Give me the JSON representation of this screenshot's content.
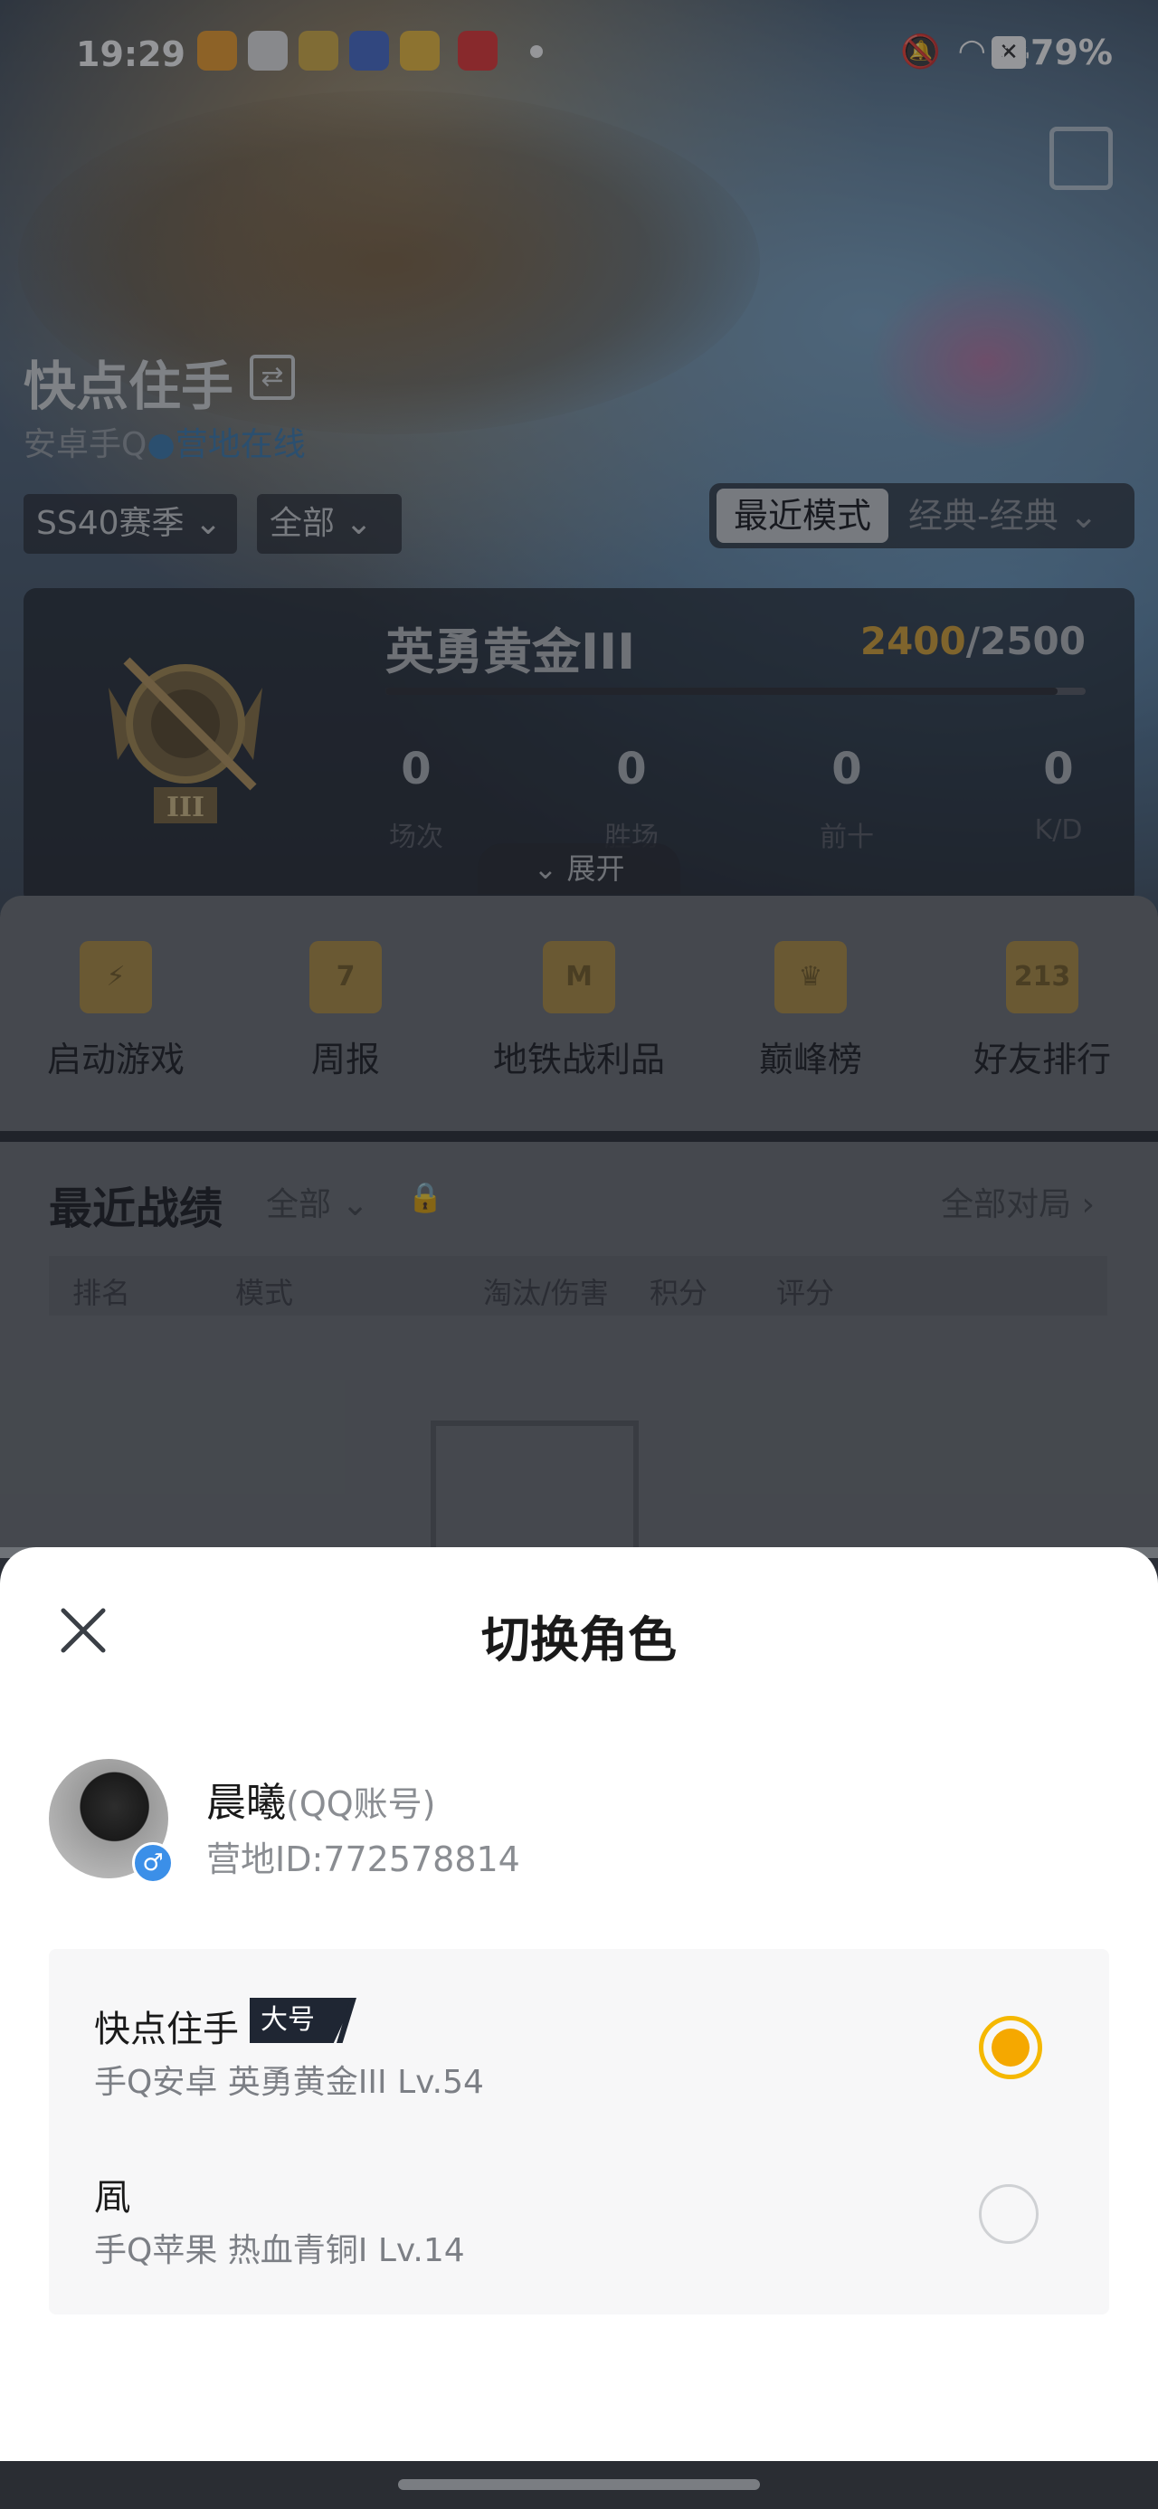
{
  "status_bar": {
    "time": "19:29",
    "battery": "79%"
  },
  "profile": {
    "name": "快点住手",
    "platform": "安卓手Q",
    "online_status": "营地在线"
  },
  "filters": {
    "season": "SS40赛季",
    "scope": "全部",
    "mode_recent": "最近模式",
    "mode_classic": "经典-经典"
  },
  "rank": {
    "name": "英勇黄金III",
    "score_current": "2400",
    "score_total": "/2500",
    "progress_fraction": 0.96,
    "badge_numeral": "III",
    "stats": [
      {
        "value": "0",
        "label": "场次"
      },
      {
        "value": "0",
        "label": "胜场"
      },
      {
        "value": "0",
        "label": "前十"
      },
      {
        "value": "0",
        "label": "K/D"
      }
    ],
    "expand_label": "展开"
  },
  "tools": [
    {
      "label": "启动游戏",
      "icon": "lightning-icon",
      "glyph": "⚡"
    },
    {
      "label": "周报",
      "icon": "calendar-icon",
      "glyph": "7"
    },
    {
      "label": "地铁战利品",
      "icon": "metro-shield-icon",
      "glyph": "M"
    },
    {
      "label": "巅峰榜",
      "icon": "crown-badge-icon",
      "glyph": "♛"
    },
    {
      "label": "好友排行",
      "icon": "podium-icon",
      "glyph": "213"
    }
  ],
  "records": {
    "title": "最近战绩",
    "filter": "全部",
    "all_matches": "全部对局",
    "columns": [
      "排名",
      "模式",
      "淘汰/伤害",
      "积分",
      "评分"
    ]
  },
  "sheet": {
    "title": "切换角色",
    "user": {
      "name": "晨曦",
      "account_type": "(QQ账号)",
      "camp_id": "营地ID:772578814",
      "gender": "♂"
    },
    "roles": [
      {
        "name": "快点住手",
        "tag": "大号",
        "detail": "手Q安卓  英勇黄金III  Lv.54",
        "selected": true
      },
      {
        "name": "凮",
        "detail": "手Q苹果  热血青铜I  Lv.14",
        "selected": false
      }
    ]
  },
  "colors": {
    "accent_gold": "#f5a800",
    "online_blue": "#3e7fb2",
    "score_gold": "#d7a43a"
  }
}
